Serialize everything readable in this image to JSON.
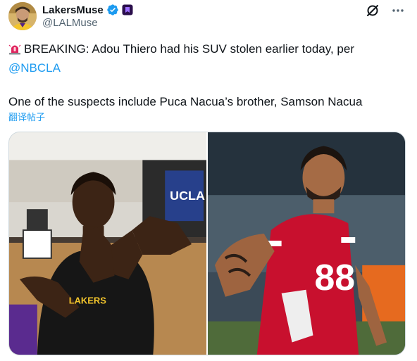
{
  "author": {
    "display_name": "LakersMuse",
    "handle": "@LALMuse",
    "verified": true,
    "affiliate_badge_icon": "affiliate-badge-icon"
  },
  "actions": {
    "grok_icon": "grok-icon",
    "more_icon": "more-icon"
  },
  "tweet": {
    "siren_icon": "siren-emoji",
    "line1_text": "BREAKING: Adou Thiero had his SUV stolen earlier today, per",
    "mention": "@NBCLA",
    "line3_text": "One of the suspects include Puca Nacua’s brother, Samson Nacua"
  },
  "translate_link": "翻译帖子",
  "media": {
    "left_photo": {
      "banner_text": "UCLA",
      "shirt_text": "LAKERS"
    },
    "right_photo": {
      "jersey_number": "88"
    }
  },
  "colors": {
    "link": "#1d9bf0",
    "text": "#0f1419",
    "secondary": "#536471",
    "verified": "#1d9bf0",
    "jersey": "#c8102e"
  }
}
